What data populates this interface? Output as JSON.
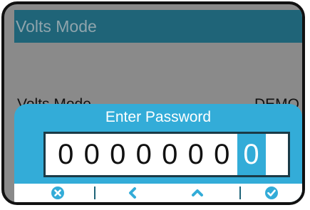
{
  "screen": {
    "title": "Volts Mode",
    "row": {
      "label": "Volts Mode",
      "value": "DEMO"
    }
  },
  "dialog": {
    "title": "Enter Password",
    "digits": [
      "0",
      "0",
      "0",
      "0",
      "0",
      "0",
      "0",
      "0"
    ],
    "active_index": 7
  },
  "buttons": [
    {
      "name": "cancel",
      "icon": "x-circle-icon"
    },
    {
      "name": "back",
      "icon": "chevron-left-icon"
    },
    {
      "name": "up",
      "icon": "chevron-up-icon"
    },
    {
      "name": "confirm",
      "icon": "check-circle-icon"
    }
  ],
  "colors": {
    "title_bar": "#1f6478",
    "accent": "#33acd8",
    "background": "#8a8a8a"
  }
}
